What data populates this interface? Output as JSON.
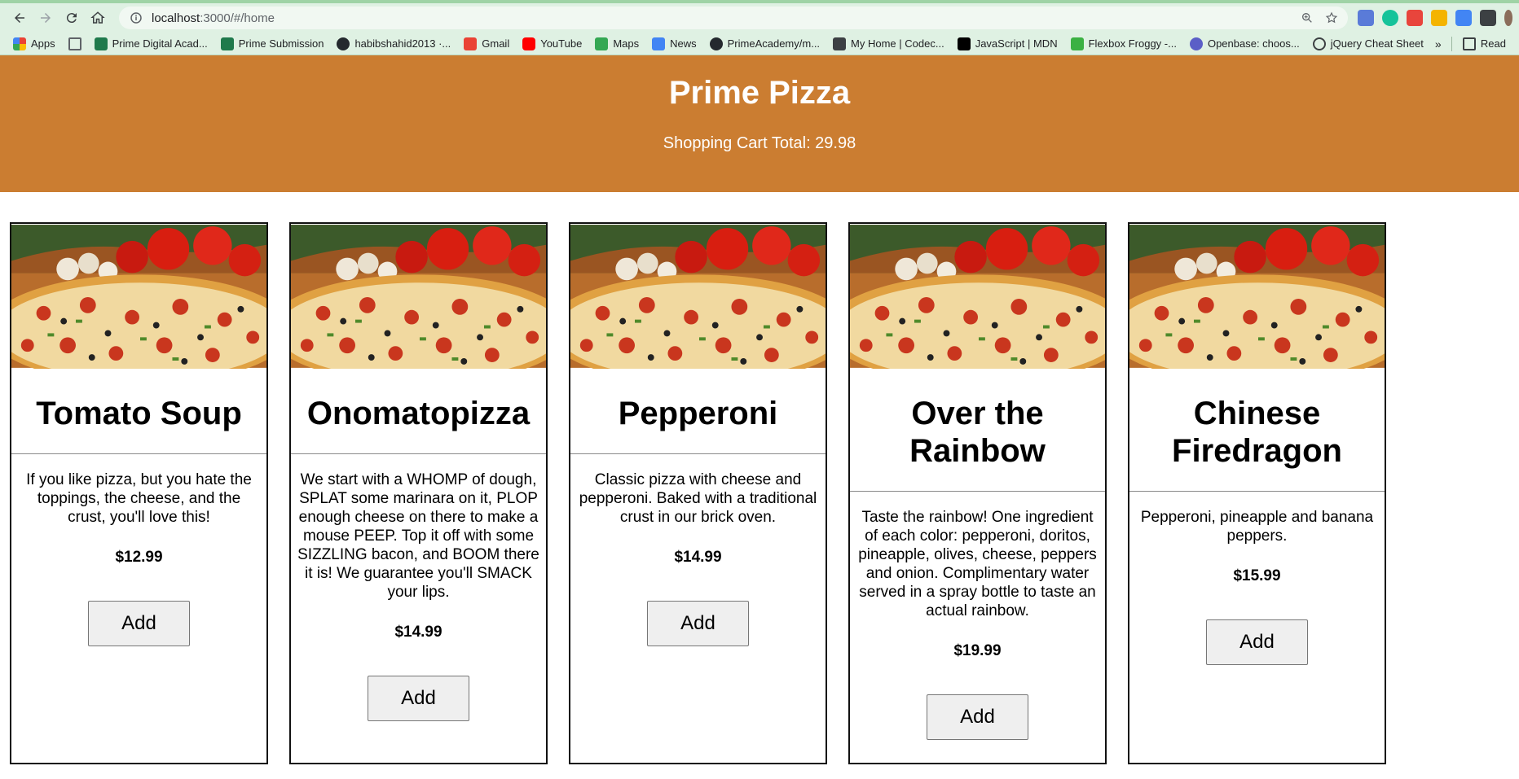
{
  "browser": {
    "url_host": "localhost",
    "url_rest": ":3000/#/home",
    "bookmarks": [
      {
        "label": "Apps",
        "color": "#e94235"
      },
      {
        "label": "",
        "color": "#5f6368"
      },
      {
        "label": "Prime Digital Acad...",
        "color": "#1f7a4c"
      },
      {
        "label": "Prime Submission",
        "color": "#1f7a4c"
      },
      {
        "label": "habibshahid2013 ·...",
        "color": "#24292e"
      },
      {
        "label": "Gmail",
        "color": "#ea4335"
      },
      {
        "label": "YouTube",
        "color": "#ff0000"
      },
      {
        "label": "Maps",
        "color": "#34a853"
      },
      {
        "label": "News",
        "color": "#4285f4"
      },
      {
        "label": "PrimeAcademy/m...",
        "color": "#24292e"
      },
      {
        "label": "My Home | Codec...",
        "color": "#3c4043"
      },
      {
        "label": "JavaScript | MDN",
        "color": "#000000"
      },
      {
        "label": "Flexbox Froggy -...",
        "color": "#3bb143"
      },
      {
        "label": "Openbase: choos...",
        "color": "#5b5fc7"
      },
      {
        "label": "jQuery Cheat Sheet",
        "color": "#3c4043"
      }
    ],
    "more": "»",
    "reading_list": "Read"
  },
  "header": {
    "title": "Prime Pizza",
    "cart_total": "Shopping Cart Total: 29.98"
  },
  "pizzas": [
    {
      "name": "Tomato Soup",
      "description": "If you like pizza, but you hate the toppings, the cheese, and the crust, you'll love this!",
      "price": "$12.99",
      "button": "Add"
    },
    {
      "name": "Onomatopizza",
      "description": "We start with a WHOMP of dough, SPLAT some marinara on it, PLOP enough cheese on there to make a mouse PEEP. Top it off with some SIZZLING bacon, and BOOM there it is! We guarantee you'll SMACK your lips.",
      "price": "$14.99",
      "button": "Add"
    },
    {
      "name": "Pepperoni",
      "description": "Classic pizza with cheese and pepperoni. Baked with a traditional crust in our brick oven.",
      "price": "$14.99",
      "button": "Add"
    },
    {
      "name": "Over the Rainbow",
      "description": "Taste the rainbow! One ingredient of each color: pepperoni, doritos, pineapple, olives, cheese, peppers and onion. Complimentary water served in a spray bottle to taste an actual rainbow.",
      "price": "$19.99",
      "button": "Add"
    },
    {
      "name": "Chinese Firedragon",
      "description": "Pepperoni, pineapple and banana peppers.",
      "price": "$15.99",
      "button": "Add"
    }
  ],
  "colors": {
    "header_bg": "#cb7d31",
    "chrome_bg": "#dff1e3"
  }
}
